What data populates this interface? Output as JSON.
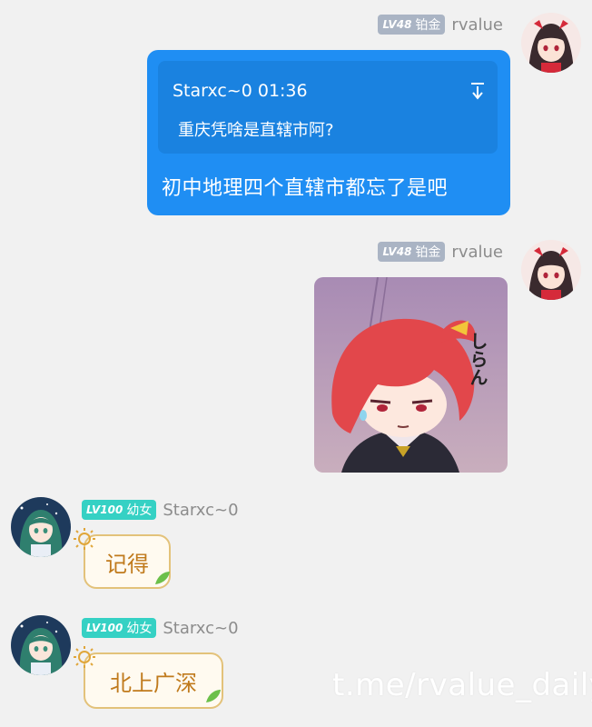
{
  "messages": [
    {
      "sender": {
        "level": "LV48",
        "title": "铂金",
        "name": "rvalue"
      },
      "quote": {
        "header": "Starxc~0 01:36",
        "text": "重庆凭啥是直辖市阿?"
      },
      "text": "初中地理四个直辖市都忘了是吧"
    },
    {
      "sender": {
        "level": "LV48",
        "title": "铂金",
        "name": "rvalue"
      },
      "sticker_text": "しらん"
    },
    {
      "sender": {
        "level": "LV100",
        "title": "幼女",
        "name": "Starxc~0"
      },
      "text": "记得"
    },
    {
      "sender": {
        "level": "LV100",
        "title": "幼女",
        "name": "Starxc~0"
      },
      "text": "北上广深"
    }
  ],
  "watermark": "t.me/rvalue_daily",
  "colors": {
    "background": "#f1f1f1",
    "blue_bubble": "#1f8ef3",
    "badge_grey": "#aab4c4",
    "badge_teal": "#35d1c4",
    "yellow_border": "#e3c27a",
    "yellow_text": "#c07a1c"
  },
  "icons": {
    "quote_jump": "arrow-down-to-line-icon",
    "bubble_sun": "sun-icon",
    "bubble_leaf": "leaf-icon"
  }
}
